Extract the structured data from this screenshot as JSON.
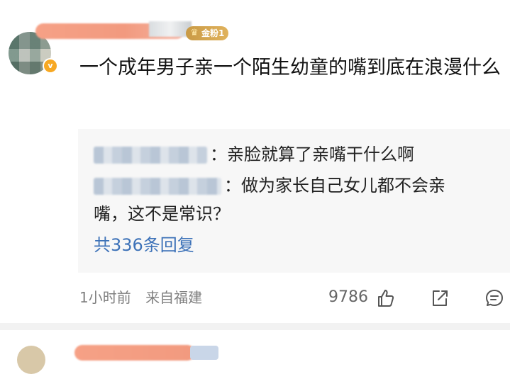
{
  "comment": {
    "fan_badge": "金粉1",
    "text": "一个成年男子亲一个陌生幼童的嘴到底在浪漫什么",
    "time": "1小时前",
    "source": "来自福建",
    "likes": "9786"
  },
  "replies": [
    {
      "prefix": "榴",
      "text": "：亲脸就算了亲嘴干什么啊"
    },
    {
      "prefix": "明",
      "text": "：做为家长自己女儿都不会亲嘴，这不是常识？"
    }
  ],
  "more_replies_label": "共336条回复",
  "icons": {
    "verified": "verified-badge-icon",
    "like": "thumbs-up-icon",
    "share": "share-icon",
    "reply": "comment-icon",
    "crown": "crown-icon"
  },
  "colors": {
    "link": "#3d72b8",
    "badge": "#d4a550",
    "verified": "#f7a823",
    "reply_bg": "#f7f7f7"
  }
}
